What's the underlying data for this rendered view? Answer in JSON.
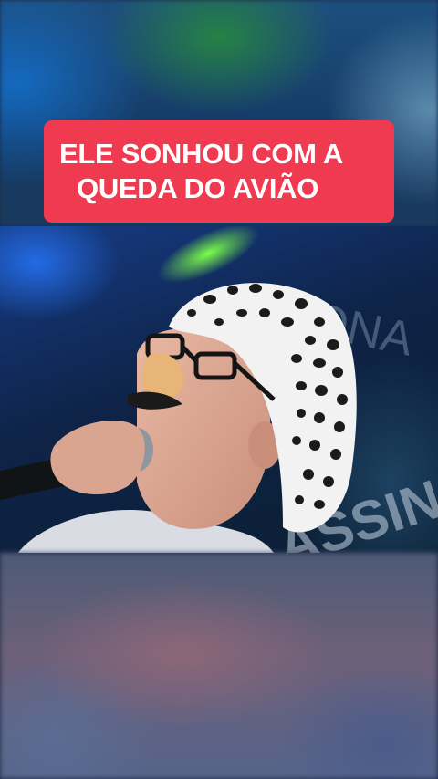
{
  "video": {
    "caption_line_1": "ELE SONHOU COM A",
    "caption_line_2": "QUEDA DO AVIÃO",
    "caption_color": "#ef3a4f",
    "caption_text_color": "#ffffff"
  },
  "photo": {
    "backdrop_text": "MONA",
    "backdrop_text_2": "ASSIN"
  }
}
